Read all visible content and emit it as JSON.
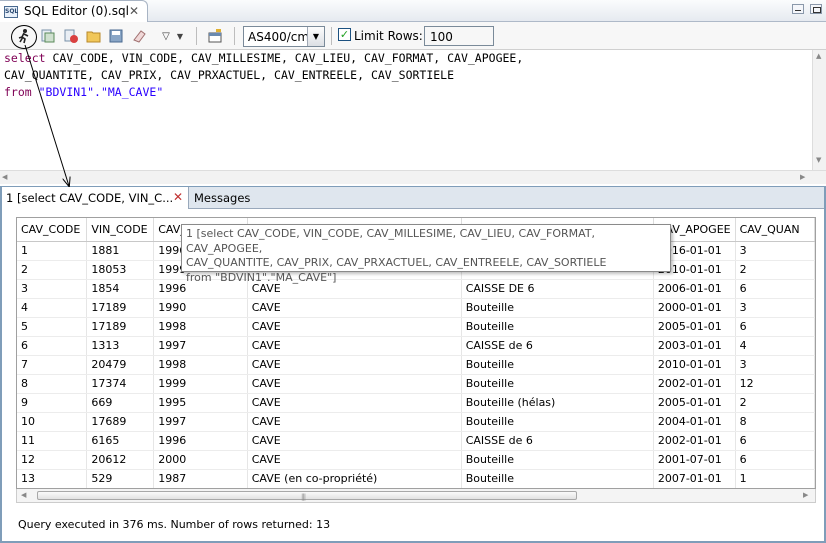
{
  "window": {
    "tab_title": "SQL Editor (0).sql",
    "tab_icon_text": "SQL"
  },
  "toolbar": {
    "icons": [
      "run-sql-icon",
      "run-script-icon",
      "cancel-icon",
      "open-file-icon",
      "save-icon",
      "clear-icon",
      "dropdown-icon",
      "chevron-down-icon",
      "schema-icon"
    ],
    "connection": "AS400/cm",
    "limit_rows_label": "Limit Rows:",
    "limit_rows_checked": true,
    "limit_rows_value": "100"
  },
  "editor": {
    "line1_kw": "select",
    "line1_rest": " CAV_CODE, VIN_CODE, CAV_MILLESIME, CAV_LIEU, CAV_FORMAT, CAV_APOGEE,",
    "line2": "CAV_QUANTITE, CAV_PRIX, CAV_PRXACTUEL, CAV_ENTREELE, CAV_SORTIELE",
    "line3_kw": "from",
    "line3_rest": " \"BDVIN1\".\"MA_CAVE\""
  },
  "results": {
    "tabs": [
      {
        "label": "1 [select CAV_CODE, VIN_C..."
      },
      {
        "label": "Messages"
      }
    ],
    "columns": [
      "CAV_CODE",
      "VIN_CODE",
      "CAV_",
      "",
      "",
      "CAV_APOGEE",
      "CAV_QUAN"
    ],
    "rows": [
      [
        "1",
        "1881",
        "1996",
        "",
        "",
        "2016-01-01",
        "3"
      ],
      [
        "2",
        "18053",
        "1999",
        "",
        "",
        "2010-01-01",
        "2"
      ],
      [
        "3",
        "1854",
        "1996",
        "CAVE",
        "CAISSE DE 6",
        "2006-01-01",
        "6"
      ],
      [
        "4",
        "17189",
        "1990",
        "CAVE",
        "Bouteille",
        "2000-01-01",
        "3"
      ],
      [
        "5",
        "17189",
        "1998",
        "CAVE",
        "Bouteille",
        "2005-01-01",
        "6"
      ],
      [
        "6",
        "1313",
        "1997",
        "CAVE",
        "CAISSE de 6",
        "2003-01-01",
        "4"
      ],
      [
        "7",
        "20479",
        "1998",
        "CAVE",
        "Bouteille",
        "2010-01-01",
        "3"
      ],
      [
        "8",
        "17374",
        "1999",
        "CAVE",
        "Bouteille",
        "2002-01-01",
        "12"
      ],
      [
        "9",
        "669",
        "1995",
        "CAVE",
        "Bouteille (hélas)",
        "2005-01-01",
        "2"
      ],
      [
        "10",
        "17689",
        "1997",
        "CAVE",
        "Bouteille",
        "2004-01-01",
        "8"
      ],
      [
        "11",
        "6165",
        "1996",
        "CAVE",
        "CAISSE de 6",
        "2002-01-01",
        "6"
      ],
      [
        "12",
        "20612",
        "2000",
        "CAVE",
        "Bouteille",
        "2001-07-01",
        "6"
      ],
      [
        "13",
        "529",
        "1987",
        "CAVE (en co-propriété)",
        "Bouteille",
        "2007-01-01",
        "1"
      ]
    ],
    "tooltip": {
      "line1": "1 [select CAV_CODE, VIN_CODE, CAV_MILLESIME, CAV_LIEU, CAV_FORMAT, CAV_APOGEE,",
      "line2": "CAV_QUANTITE, CAV_PRIX, CAV_PRXACTUEL, CAV_ENTREELE, CAV_SORTIELE",
      "line3": "from \"BDVIN1\".\"MA_CAVE\"]"
    },
    "status": "Query executed in 376 ms.  Number of rows returned: 13"
  }
}
